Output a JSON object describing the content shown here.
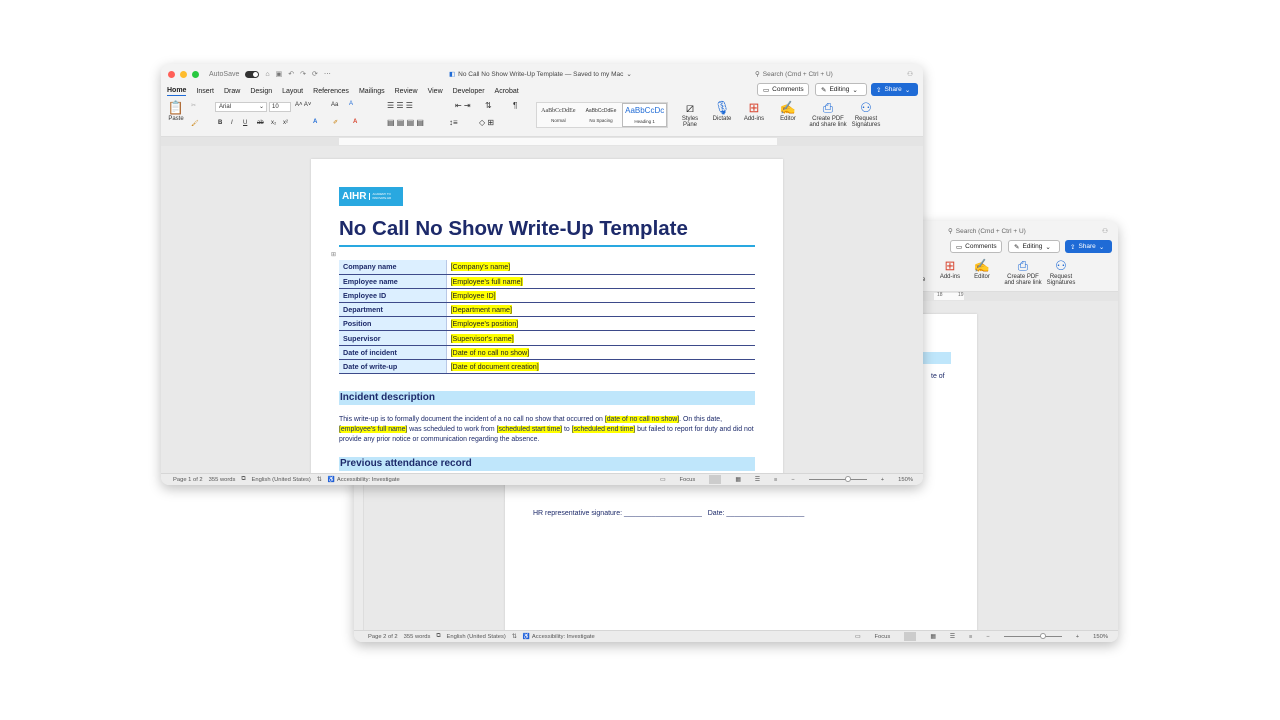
{
  "back": {
    "search": "Search (Cmd + Ctrl + U)",
    "comments": "Comments",
    "editing": "Editing",
    "share": "Share",
    "ribbon": {
      "addins": "Add-ins",
      "editor": "Editor",
      "create_pdf": "Create PDF and share link",
      "request_sig": "Request Signatures"
    },
    "ruler_nums": [
      "18",
      "19"
    ],
    "fragment_text": "te of",
    "partial_label": "e",
    "signature_line": "HR representative signature: ____________________   Date: ____________________",
    "status": {
      "page": "Page 2 of 2",
      "words": "355 words",
      "lang": "English (United States)",
      "access": "Accessibility: Investigate",
      "focus": "Focus",
      "zoom": "150%"
    }
  },
  "front": {
    "autosave": "AutoSave",
    "title": "No Call No Show Write-Up Template — Saved to my Mac",
    "search": "Search (Cmd + Ctrl + U)",
    "tabs": [
      "Home",
      "Insert",
      "Draw",
      "Design",
      "Layout",
      "References",
      "Mailings",
      "Review",
      "View",
      "Developer",
      "Acrobat"
    ],
    "comments": "Comments",
    "editing": "Editing",
    "share": "Share",
    "ribbon": {
      "paste": "Paste",
      "font": "Arial",
      "size": "10",
      "styles": [
        {
          "preview": "AaBbCcDdEe",
          "name": "Normal"
        },
        {
          "preview": "AaBbCcDdEe",
          "name": "No Spacing"
        },
        {
          "preview": "AaBbCcDc",
          "name": "Heading 1"
        }
      ],
      "styles_pane": "Styles Pane",
      "dictate": "Dictate",
      "addins": "Add-ins",
      "editor": "Editor",
      "create_pdf": "Create PDF and share link",
      "request_sig": "Request Signatures"
    },
    "status": {
      "page": "Page 1 of 2",
      "words": "355 words",
      "lang": "English (United States)",
      "access": "Accessibility: Investigate",
      "focus": "Focus",
      "zoom": "150%"
    }
  },
  "document": {
    "logo": "AIHR",
    "logo_sub": "ACADEMY TO INNOVATE HR",
    "heading": "No Call No Show Write-Up Template",
    "rows": [
      {
        "k": "Company name",
        "v": "[Company's name]"
      },
      {
        "k": "Employee name",
        "v": "[Employee's full name]"
      },
      {
        "k": "Employee ID",
        "v": "[Employee ID]"
      },
      {
        "k": "Department",
        "v": "[Department name]"
      },
      {
        "k": "Position",
        "v": "[Employee's position]"
      },
      {
        "k": "Supervisor",
        "v": "[Supervisor's name]"
      },
      {
        "k": "Date of incident",
        "v": "[Date of no call no show]"
      },
      {
        "k": "Date of write-up",
        "v": "[Date of document creation]"
      }
    ],
    "incident_heading": "Incident description",
    "incident": {
      "p1": "This write-up is to formally document the incident of a no call no show that occurred on ",
      "h1": "[date of no call no show]",
      "p2": ". On this date, ",
      "h2": "[employee's full name]",
      "p3": " was scheduled to work from ",
      "h3": "[scheduled start time]",
      "p4": " to ",
      "h4": "[scheduled end time]",
      "p5": " but failed to report for duty and did not provide any prior notice or communication regarding the absence."
    },
    "attendance_heading": "Previous attendance record"
  },
  "colors": {
    "accent": "#1f6bd6",
    "heading": "#1d2a6a",
    "cell": "#dcefff",
    "section": "#bfe6fb",
    "highlight": "#ffff00"
  }
}
